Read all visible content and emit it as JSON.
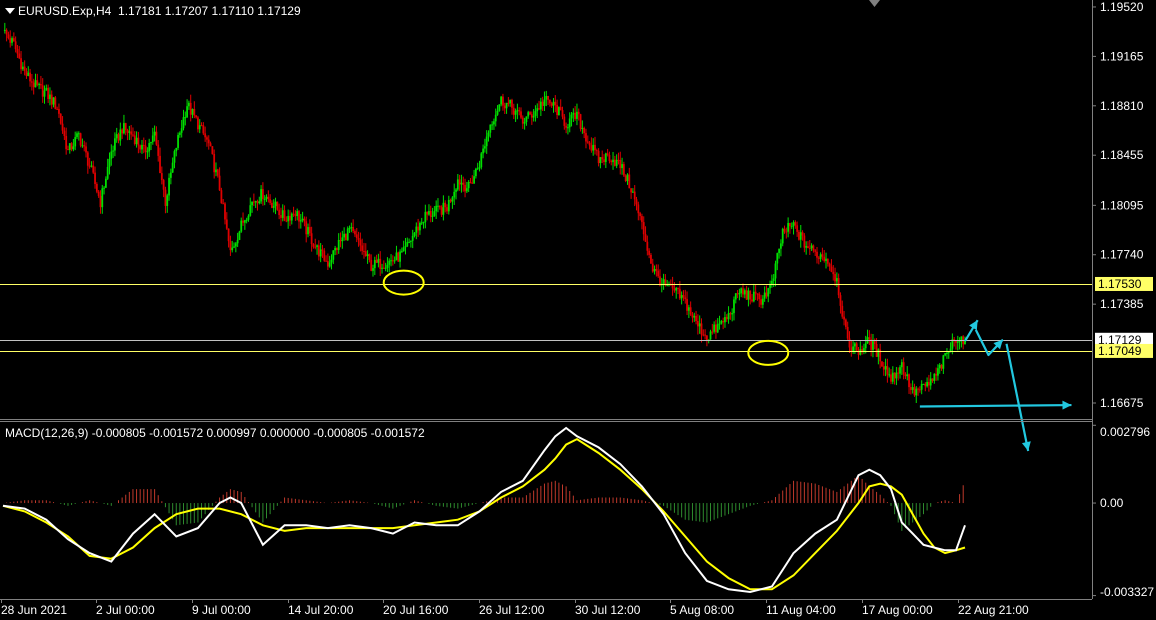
{
  "main_header": {
    "symbol_timeframe": "EURUSD.Exp,H4",
    "ohlc": "1.17181 1.17207 1.17110 1.17129"
  },
  "macd_header": "MACD(12,26,9) -0.000805 -0.001572 0.000997 0.000000 -0.000805 -0.001572",
  "colors": {
    "background": "#000000",
    "bull_candle": "#00e000",
    "bear_candle": "#e00000",
    "level_line": "#ffff66",
    "ask_line": "#c0c0c0",
    "annotation_circle": "#ffff00",
    "annotation_arrow": "#22c8e0",
    "macd_line": "#ffffff",
    "signal_line": "#ffff00",
    "hist_pos": "#c0392b",
    "hist_neg": "#2e8b2e",
    "axis": "#808080"
  },
  "chart_data": [
    {
      "type": "candlestick",
      "title": "EURUSD.Exp,H4",
      "y_ticks": [
        "1.19520",
        "1.19165",
        "1.18810",
        "1.18455",
        "1.18095",
        "1.17740",
        "1.17385",
        "1.16675"
      ],
      "ylim": [
        1.1656,
        1.1957
      ],
      "x_ticks": [
        "28 Jun 2021",
        "2 Jul 00:00",
        "9 Jul 00:00",
        "14 Jul 20:00",
        "20 Jul 16:00",
        "26 Jul 12:00",
        "30 Jul 12:00",
        "5 Aug 08:00",
        "11 Aug 04:00",
        "17 Aug 00:00",
        "22 Aug 21:00"
      ],
      "close_path": [
        [
          0,
          1.1935
        ],
        [
          6,
          1.1925
        ],
        [
          12,
          1.1905
        ],
        [
          18,
          1.1895
        ],
        [
          24,
          1.189
        ],
        [
          30,
          1.188
        ],
        [
          36,
          1.1848
        ],
        [
          42,
          1.186
        ],
        [
          48,
          1.1838
        ],
        [
          54,
          1.1812
        ],
        [
          60,
          1.1848
        ],
        [
          66,
          1.1865
        ],
        [
          72,
          1.186
        ],
        [
          78,
          1.1848
        ],
        [
          84,
          1.186
        ],
        [
          90,
          1.1812
        ],
        [
          96,
          1.1852
        ],
        [
          102,
          1.1882
        ],
        [
          108,
          1.1868
        ],
        [
          114,
          1.1853
        ],
        [
          120,
          1.1822
        ],
        [
          126,
          1.1775
        ],
        [
          132,
          1.1795
        ],
        [
          138,
          1.1812
        ],
        [
          144,
          1.1818
        ],
        [
          150,
          1.181
        ],
        [
          156,
          1.18
        ],
        [
          162,
          1.1805
        ],
        [
          168,
          1.1792
        ],
        [
          174,
          1.1778
        ],
        [
          180,
          1.1768
        ],
        [
          186,
          1.1782
        ],
        [
          192,
          1.1792
        ],
        [
          198,
          1.178
        ],
        [
          204,
          1.1766
        ],
        [
          210,
          1.1768
        ],
        [
          216,
          1.177
        ],
        [
          222,
          1.1775
        ],
        [
          228,
          1.179
        ],
        [
          234,
          1.1802
        ],
        [
          240,
          1.1805
        ],
        [
          246,
          1.1808
        ],
        [
          252,
          1.1828
        ],
        [
          258,
          1.1822
        ],
        [
          264,
          1.184
        ],
        [
          270,
          1.1868
        ],
        [
          276,
          1.1885
        ],
        [
          282,
          1.188
        ],
        [
          288,
          1.187
        ],
        [
          294,
          1.1876
        ],
        [
          300,
          1.1885
        ],
        [
          306,
          1.188
        ],
        [
          312,
          1.1868
        ],
        [
          318,
          1.1874
        ],
        [
          324,
          1.1856
        ],
        [
          330,
          1.1842
        ],
        [
          336,
          1.1845
        ],
        [
          342,
          1.1838
        ],
        [
          348,
          1.1822
        ],
        [
          354,
          1.1795
        ],
        [
          360,
          1.1764
        ],
        [
          366,
          1.1752
        ],
        [
          372,
          1.1748
        ],
        [
          378,
          1.174
        ],
        [
          384,
          1.1725
        ],
        [
          390,
          1.1715
        ],
        [
          396,
          1.1722
        ],
        [
          402,
          1.173
        ],
        [
          408,
          1.1748
        ],
        [
          414,
          1.1744
        ],
        [
          420,
          1.1742
        ],
        [
          426,
          1.1752
        ],
        [
          432,
          1.179
        ],
        [
          438,
          1.1795
        ],
        [
          444,
          1.1782
        ],
        [
          450,
          1.1775
        ],
        [
          456,
          1.1772
        ],
        [
          462,
          1.1756
        ],
        [
          468,
          1.171
        ],
        [
          474,
          1.1705
        ],
        [
          480,
          1.1712
        ],
        [
          486,
          1.17
        ],
        [
          492,
          1.1685
        ],
        [
          498,
          1.1695
        ],
        [
          504,
          1.1675
        ],
        [
          510,
          1.1678
        ],
        [
          516,
          1.1685
        ],
        [
          522,
          1.17
        ],
        [
          528,
          1.1715
        ],
        [
          533,
          1.1713
        ]
      ],
      "price_levels": [
        {
          "value": 1.1753,
          "label": "1.17530",
          "style": "level"
        },
        {
          "value": 1.17129,
          "label": "1.17129",
          "style": "ask"
        },
        {
          "value": 1.17049,
          "label": "1.17049",
          "style": "level"
        }
      ],
      "annotations": [
        {
          "shape": "ellipse",
          "bar": 222,
          "price": 1.1754
        },
        {
          "shape": "ellipse",
          "bar": 424,
          "price": 1.17035
        },
        {
          "shape": "arrow",
          "points": [
            [
              533,
              1.1712
            ],
            [
              540,
              1.1727
            ]
          ]
        },
        {
          "shape": "arrow",
          "points": [
            [
              539,
              1.172
            ],
            [
              546,
              1.1702
            ],
            [
              554,
              1.1713
            ]
          ]
        },
        {
          "shape": "arrow",
          "points": [
            [
              556,
              1.171
            ],
            [
              568,
              1.1633
            ]
          ]
        },
        {
          "shape": "arrow",
          "points": [
            [
              508,
              1.1665
            ],
            [
              592,
              1.1666
            ]
          ]
        }
      ]
    },
    {
      "type": "macd",
      "title": "MACD(12,26,9)",
      "y_ticks": [
        "0.002796",
        "0.00",
        "-0.003327"
      ],
      "ylim": [
        -0.00345,
        0.00295
      ],
      "macd_path": [
        [
          0,
          -0.0001
        ],
        [
          12,
          -0.0002
        ],
        [
          24,
          -0.0006
        ],
        [
          36,
          -0.0013
        ],
        [
          48,
          -0.0018
        ],
        [
          60,
          -0.0021
        ],
        [
          72,
          -0.0011
        ],
        [
          84,
          -0.0004
        ],
        [
          96,
          -0.0012
        ],
        [
          108,
          -0.0009
        ],
        [
          120,
          0.0
        ],
        [
          126,
          0.0002
        ],
        [
          132,
          0.0
        ],
        [
          144,
          -0.0015
        ],
        [
          156,
          -0.0008
        ],
        [
          168,
          -0.0008
        ],
        [
          180,
          -0.0009
        ],
        [
          192,
          -0.0008
        ],
        [
          204,
          -0.0009
        ],
        [
          216,
          -0.0011
        ],
        [
          228,
          -0.0007
        ],
        [
          240,
          -0.0008
        ],
        [
          252,
          -0.0008
        ],
        [
          264,
          -0.0003
        ],
        [
          276,
          0.0004
        ],
        [
          288,
          0.0008
        ],
        [
          300,
          0.0019
        ],
        [
          306,
          0.0024
        ],
        [
          312,
          0.0027
        ],
        [
          318,
          0.0024
        ],
        [
          330,
          0.002
        ],
        [
          342,
          0.0014
        ],
        [
          354,
          0.0006
        ],
        [
          366,
          -0.0004
        ],
        [
          378,
          -0.0018
        ],
        [
          390,
          -0.0028
        ],
        [
          402,
          -0.0031
        ],
        [
          414,
          -0.0032
        ],
        [
          426,
          -0.003
        ],
        [
          438,
          -0.0018
        ],
        [
          450,
          -0.0011
        ],
        [
          462,
          -0.0006
        ],
        [
          468,
          0.0002
        ],
        [
          474,
          0.001
        ],
        [
          480,
          0.0012
        ],
        [
          486,
          0.001
        ],
        [
          492,
          0.0005
        ],
        [
          498,
          -0.0007
        ],
        [
          504,
          -0.0011
        ],
        [
          510,
          -0.0015
        ],
        [
          522,
          -0.0017
        ],
        [
          528,
          -0.0017
        ],
        [
          533,
          -0.0008
        ]
      ],
      "signal_path": [
        [
          0,
          -0.0001
        ],
        [
          12,
          -0.0003
        ],
        [
          24,
          -0.0007
        ],
        [
          36,
          -0.0012
        ],
        [
          48,
          -0.0019
        ],
        [
          60,
          -0.002
        ],
        [
          72,
          -0.0016
        ],
        [
          84,
          -0.0009
        ],
        [
          96,
          -0.0004
        ],
        [
          108,
          -0.0002
        ],
        [
          120,
          -0.0002
        ],
        [
          132,
          -0.0004
        ],
        [
          144,
          -0.0008
        ],
        [
          156,
          -0.001
        ],
        [
          168,
          -0.0009
        ],
        [
          180,
          -0.0009
        ],
        [
          192,
          -0.0009
        ],
        [
          204,
          -0.0009
        ],
        [
          216,
          -0.0009
        ],
        [
          228,
          -0.0008
        ],
        [
          240,
          -0.0007
        ],
        [
          252,
          -0.0006
        ],
        [
          264,
          -0.0003
        ],
        [
          276,
          0.0002
        ],
        [
          288,
          0.0006
        ],
        [
          300,
          0.0012
        ],
        [
          306,
          0.0016
        ],
        [
          312,
          0.0021
        ],
        [
          318,
          0.0023
        ],
        [
          330,
          0.0018
        ],
        [
          342,
          0.0012
        ],
        [
          354,
          0.0005
        ],
        [
          366,
          -0.0003
        ],
        [
          378,
          -0.0012
        ],
        [
          390,
          -0.0021
        ],
        [
          402,
          -0.0027
        ],
        [
          414,
          -0.0031
        ],
        [
          426,
          -0.0031
        ],
        [
          438,
          -0.0026
        ],
        [
          450,
          -0.0018
        ],
        [
          462,
          -0.001
        ],
        [
          474,
          0.0
        ],
        [
          480,
          0.0006
        ],
        [
          486,
          0.0007
        ],
        [
          492,
          0.0006
        ],
        [
          498,
          0.0003
        ],
        [
          504,
          -0.0004
        ],
        [
          510,
          -0.0011
        ],
        [
          516,
          -0.0016
        ],
        [
          522,
          -0.0018
        ],
        [
          528,
          -0.0017
        ],
        [
          533,
          -0.0016
        ]
      ]
    }
  ]
}
